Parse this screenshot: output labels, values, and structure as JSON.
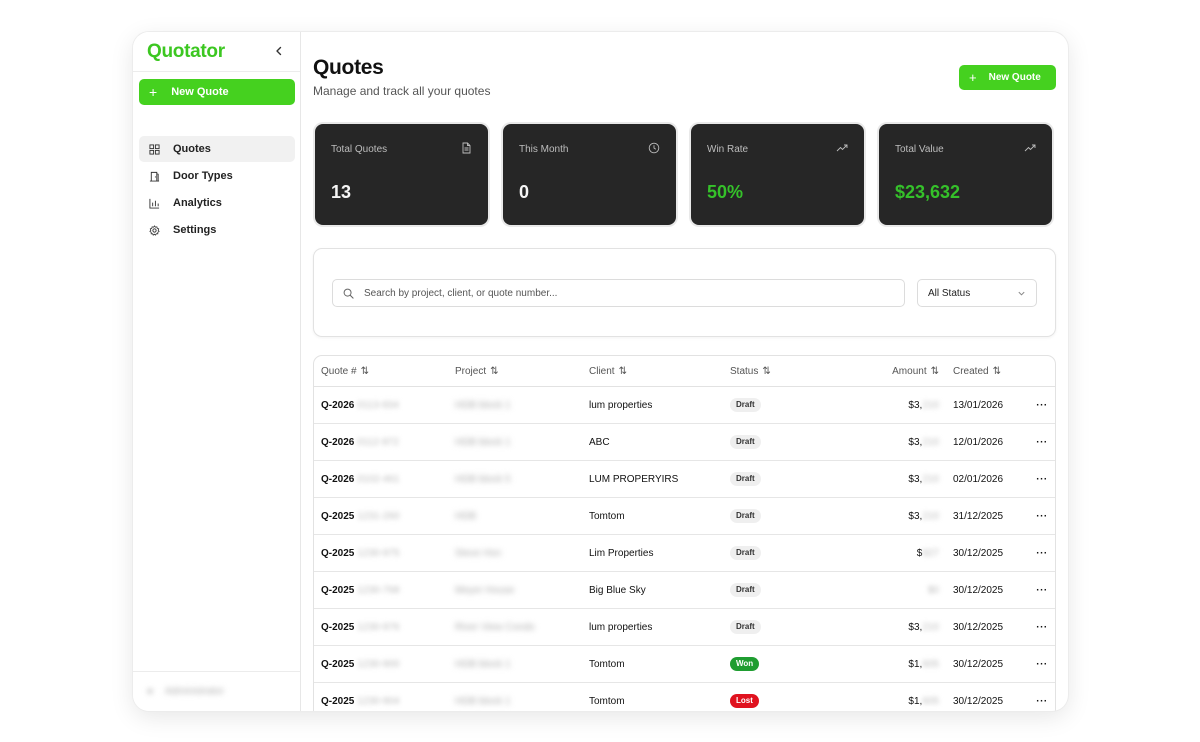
{
  "sidebar": {
    "brand": "Quotator",
    "collapse_icon": "chevron-left-icon",
    "new_quote_label": "New Quote",
    "items": [
      {
        "label": "Quotes",
        "icon": "grid-icon",
        "active": true
      },
      {
        "label": "Door Types",
        "icon": "door-icon",
        "active": false
      },
      {
        "label": "Analytics",
        "icon": "bar-chart-icon",
        "active": false
      },
      {
        "label": "Settings",
        "icon": "gear-icon",
        "active": false
      }
    ],
    "footer_label": "Administrator"
  },
  "header": {
    "title": "Quotes",
    "subtitle": "Manage and track all your quotes",
    "new_quote_label": "New Quote"
  },
  "stats": [
    {
      "label": "Total Quotes",
      "value": "13",
      "icon": "document-icon"
    },
    {
      "label": "This Month",
      "value": "0",
      "icon": "clock-icon"
    },
    {
      "label": "Win Rate",
      "value": "50%",
      "icon": "trending-up-icon"
    },
    {
      "label": "Total Value",
      "value": "$23,632",
      "icon": "trending-up-icon"
    }
  ],
  "filters": {
    "search_placeholder": "Search by project, client, or quote number...",
    "status_selected": "All Status"
  },
  "table": {
    "columns": [
      "Quote #",
      "Project",
      "Client",
      "Status",
      "Amount",
      "Created"
    ],
    "rows": [
      {
        "quote": "Q-2026",
        "quote_rest": "0113-934",
        "project": "HDB block 1",
        "client": "lum properties",
        "status": "Draft",
        "amount": "$3,",
        "amount_rest": "210",
        "created": "13/01/2026"
      },
      {
        "quote": "Q-2026",
        "quote_rest": "0112-972",
        "project": "HDB block 1",
        "client": "ABC",
        "status": "Draft",
        "amount": "$3,",
        "amount_rest": "210",
        "created": "12/01/2026"
      },
      {
        "quote": "Q-2026",
        "quote_rest": "0102-461",
        "project": "HDB block 5",
        "client": "LUM PROPERYIRS",
        "status": "Draft",
        "amount": "$3,",
        "amount_rest": "210",
        "created": "02/01/2026"
      },
      {
        "quote": "Q-2025",
        "quote_rest": "1231-260",
        "project": "HDB",
        "client": "Tomtom",
        "status": "Draft",
        "amount": "$3,",
        "amount_rest": "210",
        "created": "31/12/2025"
      },
      {
        "quote": "Q-2025",
        "quote_rest": "1230-975",
        "project": "Steve Hsn",
        "client": "Lim Properties",
        "status": "Draft",
        "amount": "$",
        "amount_rest": "927",
        "created": "30/12/2025"
      },
      {
        "quote": "Q-2025",
        "quote_rest": "1230-768",
        "project": "Meyer House",
        "client": "Big Blue Sky",
        "status": "Draft",
        "amount": "",
        "amount_rest": "$0",
        "created": "30/12/2025"
      },
      {
        "quote": "Q-2025",
        "quote_rest": "1230-976",
        "project": "River View Condo",
        "client": "lum properties",
        "status": "Draft",
        "amount": "$3,",
        "amount_rest": "210",
        "created": "30/12/2025"
      },
      {
        "quote": "Q-2025",
        "quote_rest": "1230-900",
        "project": "HDB block 1",
        "client": "Tomtom",
        "status": "Won",
        "amount": "$1,",
        "amount_rest": "605",
        "created": "30/12/2025"
      },
      {
        "quote": "Q-2025",
        "quote_rest": "1230-904",
        "project": "HDB block 1",
        "client": "Tomtom",
        "status": "Lost",
        "amount": "$1,",
        "amount_rest": "605",
        "created": "30/12/2025"
      }
    ],
    "row_action_icon": "more-horizontal-icon"
  },
  "colors": {
    "brand": "#3cc721",
    "button": "#45d11f",
    "card_bg": "#262626",
    "won": "#1f9d31",
    "lost": "#e0121f"
  }
}
